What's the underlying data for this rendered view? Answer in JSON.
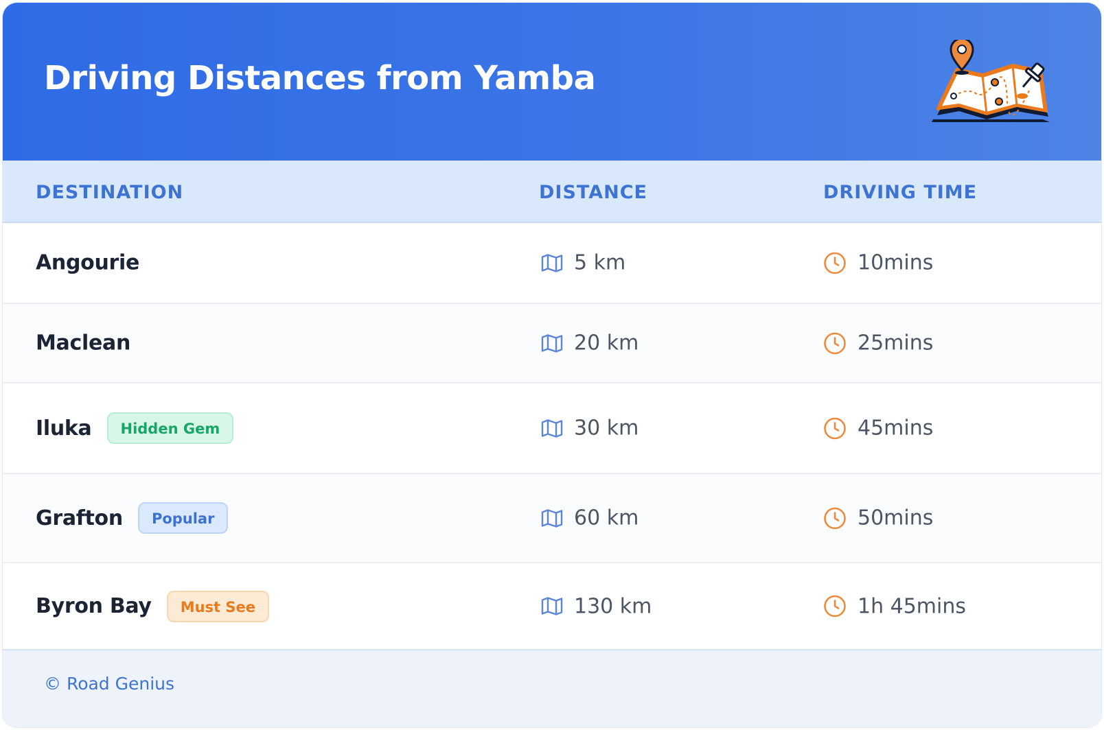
{
  "header": {
    "title": "Driving Distances from Yamba",
    "illustration_icon": "map-with-pins-icon"
  },
  "table": {
    "columns": [
      "DESTINATION",
      "DISTANCE",
      "DRIVING TIME"
    ],
    "distance_icon": "map-icon",
    "time_icon": "clock-icon",
    "rows": [
      {
        "destination": "Angourie",
        "badge": "",
        "distance": "5 km",
        "time": "10mins"
      },
      {
        "destination": "Maclean",
        "badge": "",
        "distance": "20 km",
        "time": "25mins"
      },
      {
        "destination": "Iluka",
        "badge": "Hidden Gem",
        "distance": "30 km",
        "time": "45mins"
      },
      {
        "destination": "Grafton",
        "badge": "Popular",
        "distance": "60 km",
        "time": "50mins"
      },
      {
        "destination": "Byron Bay",
        "badge": "Must See",
        "distance": "130 km",
        "time": "1h 45mins"
      }
    ]
  },
  "footer": {
    "text": "© Road Genius"
  },
  "colors": {
    "header_gradient_start": "#2f6be6",
    "header_gradient_end": "#4e84e6",
    "accent_blue": "#3d74d4",
    "accent_orange": "#ed8a3e",
    "badge_green": "#18a567",
    "badge_orange": "#ea7a1c"
  }
}
